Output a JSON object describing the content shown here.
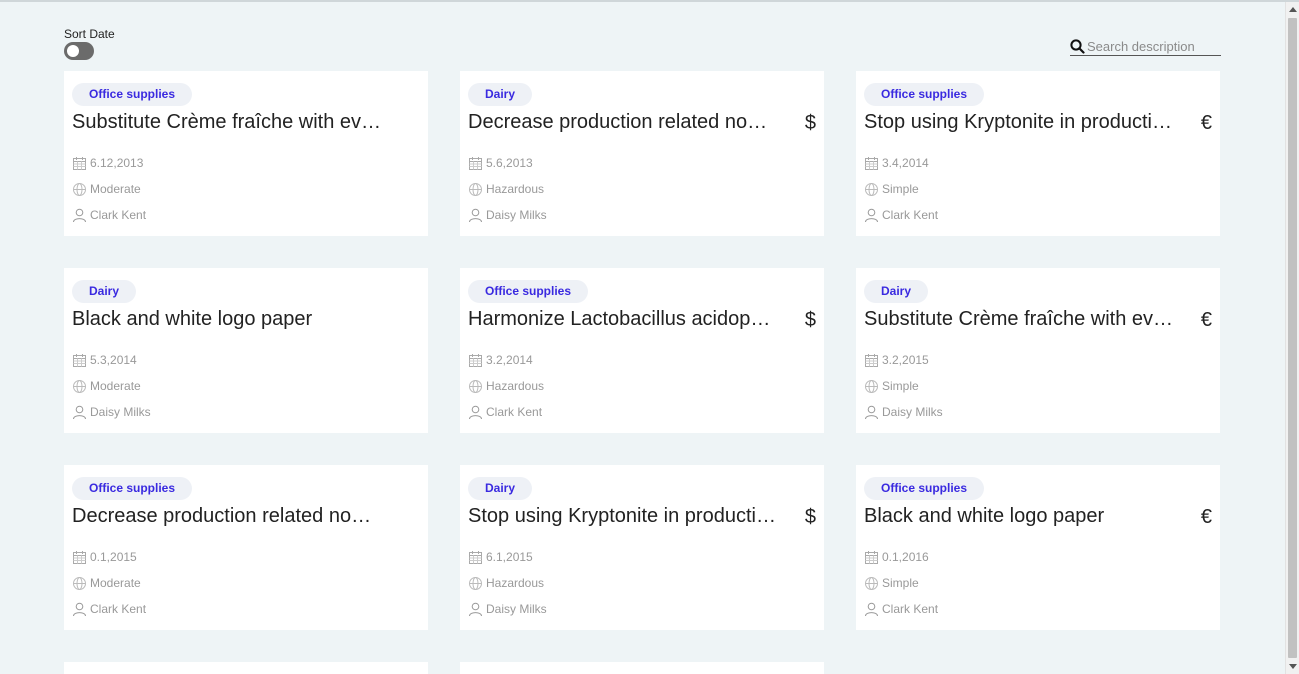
{
  "sort": {
    "label": "Sort Date",
    "enabled": false
  },
  "search": {
    "placeholder": "Search description"
  },
  "cards": [
    {
      "category": "Office supplies",
      "title": "Substitute Crème fraîche with evaporated milk in ice-cream products",
      "currency": "",
      "date": "6.12,2013",
      "difficulty": "Moderate",
      "person": "Clark Kent"
    },
    {
      "category": "Dairy",
      "title": "Decrease production related non-recyclable waste",
      "currency": "$",
      "date": "5.6,2013",
      "difficulty": "Hazardous",
      "person": "Daisy Milks"
    },
    {
      "category": "Office supplies",
      "title": "Stop using Kryptonite in production",
      "currency": "€",
      "date": "3.4,2014",
      "difficulty": "Simple",
      "person": "Clark Kent"
    },
    {
      "category": "Dairy",
      "title": "Black and white logo paper",
      "currency": "",
      "date": "5.3,2014",
      "difficulty": "Moderate",
      "person": "Daisy Milks"
    },
    {
      "category": "Office supplies",
      "title": "Harmonize Lactobacillus acidophilus sourcing",
      "currency": "$",
      "date": "3.2,2014",
      "difficulty": "Hazardous",
      "person": "Clark Kent"
    },
    {
      "category": "Dairy",
      "title": "Substitute Crème fraîche with evaporated milk in ice-cream products",
      "currency": "€",
      "date": "3.2,2015",
      "difficulty": "Simple",
      "person": "Daisy Milks"
    },
    {
      "category": "Office supplies",
      "title": "Decrease production related non-recyclable waste",
      "currency": "",
      "date": "0.1,2015",
      "difficulty": "Moderate",
      "person": "Clark Kent"
    },
    {
      "category": "Dairy",
      "title": "Stop using Kryptonite in production",
      "currency": "$",
      "date": "6.1,2015",
      "difficulty": "Hazardous",
      "person": "Daisy Milks"
    },
    {
      "category": "Office supplies",
      "title": "Black and white logo paper",
      "currency": "€",
      "date": "0.1,2016",
      "difficulty": "Simple",
      "person": "Clark Kent"
    }
  ]
}
